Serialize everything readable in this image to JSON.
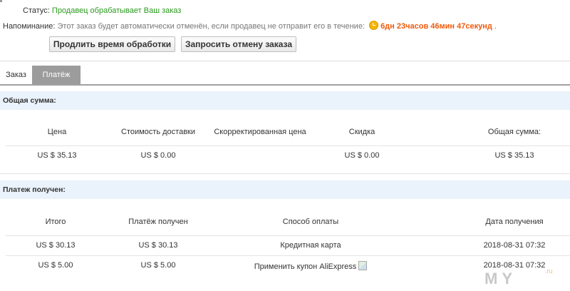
{
  "status": {
    "label": "Статус:",
    "value": "Продавец обрабатывает Ваш заказ"
  },
  "reminder": {
    "label": "Напоминание:",
    "text": "Этот заказ будет автоматически отменён, если продавец не отправит его в течение:",
    "timer": "6дн 23часов 46мин 47секунд",
    "suffix": "."
  },
  "buttons": {
    "extend": "Продлить время обработки",
    "cancel": "Запросить отмену заказа"
  },
  "tabs": [
    {
      "label": "Заказ"
    },
    {
      "label": "Платёж"
    }
  ],
  "total_section": {
    "title": "Общая сумма:",
    "headers": [
      "Цена",
      "Стоимость доставки",
      "Скорректированная цена",
      "Скидка",
      "Общая сумма:"
    ],
    "row": [
      "US $ 35.13",
      "US $ 0.00",
      "",
      "US $ 0.00",
      "US $ 35.13"
    ]
  },
  "payment_section": {
    "title": "Платеж получен:",
    "headers": [
      "Итого",
      "Платёж получен",
      "Способ оплаты",
      "Дата получения"
    ],
    "rows": [
      [
        "US $ 30.13",
        "US $ 30.13",
        "Кредитная карта",
        "2018-08-31 07:32"
      ],
      [
        "US $ 5.00",
        "US $ 5.00",
        "Применить купон AliExpress",
        "2018-08-31 07:32"
      ]
    ]
  },
  "watermark": {
    "text": "MY",
    "sub": ".ru"
  },
  "colors": {
    "status_green": "#2a9a1c",
    "timer_orange": "#f05a0c",
    "section_bg": "#eaf2fb",
    "active_tab": "#9c9c9c"
  }
}
